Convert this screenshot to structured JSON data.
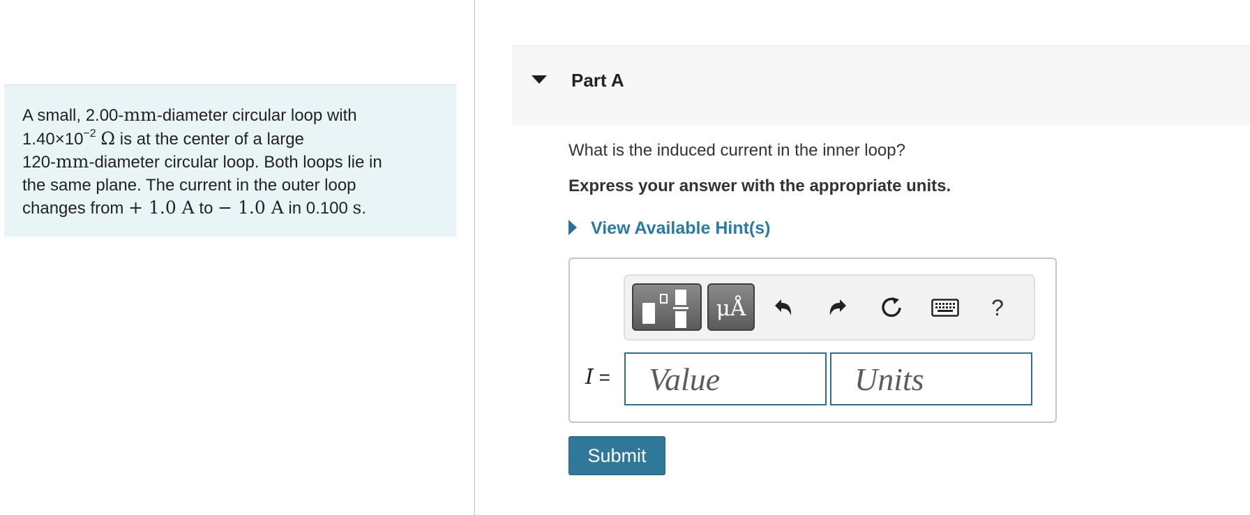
{
  "problem": {
    "line1": {
      "a": "A small, 2.00-",
      "unit": "mm",
      "b": "-diameter circular loop with"
    },
    "line2": {
      "coef": "1.40×10",
      "exp": "−2",
      "unit": "Ω",
      "b": " is at the center of a large"
    },
    "line3": {
      "a": "120-",
      "unit": "mm",
      "b": "-diameter circular loop. Both loops lie in"
    },
    "line4": "the same plane. The current in the outer loop",
    "line5": {
      "a": "changes from ",
      "from": "+ 1.0 A",
      "b": " to ",
      "to": "− 1.0 A",
      "c": " in 0.100 ",
      "unit": "s",
      "d": "."
    }
  },
  "part": {
    "title": "Part A"
  },
  "question": "What is the induced current in the inner loop?",
  "instruction": "Express your answer with the appropriate units.",
  "hints": {
    "label": "View Available Hint(s)"
  },
  "toolbar": {
    "templates_icon": "templates-icon",
    "units_label": "μÅ",
    "undo_icon": "undo-icon",
    "redo_icon": "redo-icon",
    "reset_icon": "reset-icon",
    "keyboard_icon": "keyboard-icon",
    "help_label": "?"
  },
  "answer": {
    "variable": "I",
    "equals": " =",
    "value_placeholder": "Value",
    "units_placeholder": "Units"
  },
  "submit_label": "Submit",
  "colors": {
    "problem_bg": "#e9f4f6",
    "link": "#2a7aa5",
    "submit_bg": "#2f789a",
    "field_border": "#2f6e92"
  }
}
